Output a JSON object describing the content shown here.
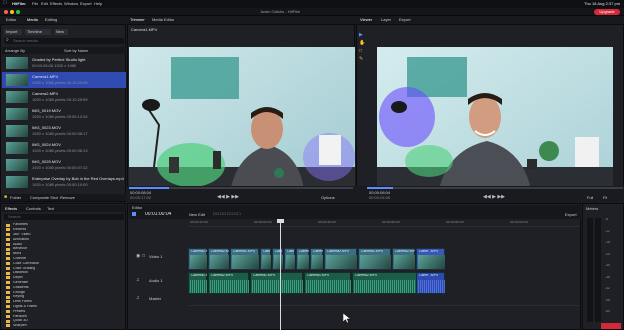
{
  "os_menu": {
    "app": "HitFilm",
    "items": [
      "File",
      "Edit",
      "Effects",
      "Window",
      "Export",
      "Help"
    ],
    "clock": "Thu 18 Aug 2:37 pm"
  },
  "window": {
    "title": "HitFilm",
    "doc_title": "Justin Odisho - HitFilm",
    "upgrade_label": "Upgrade"
  },
  "app_tabs": [
    "Editor",
    "Media",
    "Editing"
  ],
  "media_panel": {
    "tabs": [
      "Media",
      "Assets",
      "Grid"
    ],
    "import_label": "Import",
    "folder_label": "Timeline",
    "new_label": "New",
    "search_placeholder": "Search media",
    "arrange_label": "Arrange By",
    "sort_label": "Sort by Name",
    "items": [
      {
        "name": "Graded by Perfect Studio light",
        "meta": "00:00:05:06  1920 x 1080"
      },
      {
        "name": "Camera1.MP4",
        "meta": "1920 x 1080 pixels  00:10:29:59"
      },
      {
        "name": "Camera2.MP4",
        "meta": "1920 x 1080 pixels  00:10:29:59"
      },
      {
        "name": "IMG_0019.MOV",
        "meta": "1920 x 1080 pixels  00:00:12:04"
      },
      {
        "name": "IMG_0023.MOV",
        "meta": "1920 x 1080 pixels  00:00:08:17"
      },
      {
        "name": "IMG_0024.MOV",
        "meta": "1920 x 1080 pixels  00:00:06:13"
      },
      {
        "name": "IMG_0025.MOV",
        "meta": "1920 x 1080 pixels  00:00:07:22"
      },
      {
        "name": "Enterprise Overlay by Bob in the Red Overlays.mp4",
        "meta": "1920 x 1080 pixels  00:00:10:00"
      }
    ],
    "footer": [
      "Folder",
      "Composite Shot",
      "Remove"
    ]
  },
  "effects_panel": {
    "tabs": [
      "Effects",
      "Controls",
      "Text"
    ],
    "search_placeholder": "Search",
    "categories": [
      "Favorites",
      "Recents",
      "360° Video",
      "Animation",
      "Audio",
      "Behavior",
      "Blurs",
      "Channel",
      "Color Correction",
      "Color Grading",
      "Distortion",
      "Depth",
      "Generate",
      "Gradients",
      "Grunge",
      "Keying",
      "Lens Flares",
      "Lights & Flares",
      "Presets",
      "Particles",
      "Quick 3D",
      "Sharpen"
    ]
  },
  "viewer_left": {
    "tabs": [
      "Trimmer",
      "Media Editor"
    ],
    "clip_label": "Camera1.MP4",
    "timecode": "00:00:08:04",
    "end_timecode": "00:00:17:02"
  },
  "viewer_right": {
    "tabs": [
      "Viewer",
      "Layer",
      "Export"
    ],
    "timecode": "00:00:08:04",
    "end_timecode": "00:00:04:00",
    "zoom": "Full",
    "fit_label": "Fit"
  },
  "transport": {
    "options_label": "Options",
    "full_label": "Full"
  },
  "timeline": {
    "label": "Editor",
    "timecode": "00:01:00:04",
    "new_edit_label": "New Edit",
    "export_label": "Export",
    "tracks": {
      "video": "Video 1",
      "audio": "Audio 1",
      "master": "Master"
    },
    "ruler": [
      "00:00:10:00",
      "00:00:20:00",
      "00:00:30:00",
      "00:00:40:00",
      "00:00:50:00",
      "00:01:00:00"
    ],
    "clips_video": [
      "Camera1.MP4",
      "Camera2.MP4",
      "Camera1.MP4",
      "Cam",
      "Cam",
      "Cam",
      "Camera2",
      "Camera1",
      "Camera2.MP4",
      "Camera1.MP4",
      "Camera2.MP4",
      "Came...MP4"
    ],
    "clips_audio": [
      "Camera1.MP4",
      "Camera2.MP4",
      "Camera1.MP4",
      "Camera1.MP4",
      "Camera2.MP4",
      "Came...MP4"
    ]
  },
  "meters": {
    "label": "Meters",
    "scale": [
      "-6",
      "-12",
      "-18",
      "-24",
      "-30",
      "-36",
      "-42",
      "-48",
      "-54"
    ]
  },
  "colors": {
    "accent_red": "#d6283b",
    "selection_blue": "#3a56b8",
    "playhead": "#5d8cff",
    "clip_video": "#3d6d84",
    "clip_audio": "#1d5c4a"
  }
}
